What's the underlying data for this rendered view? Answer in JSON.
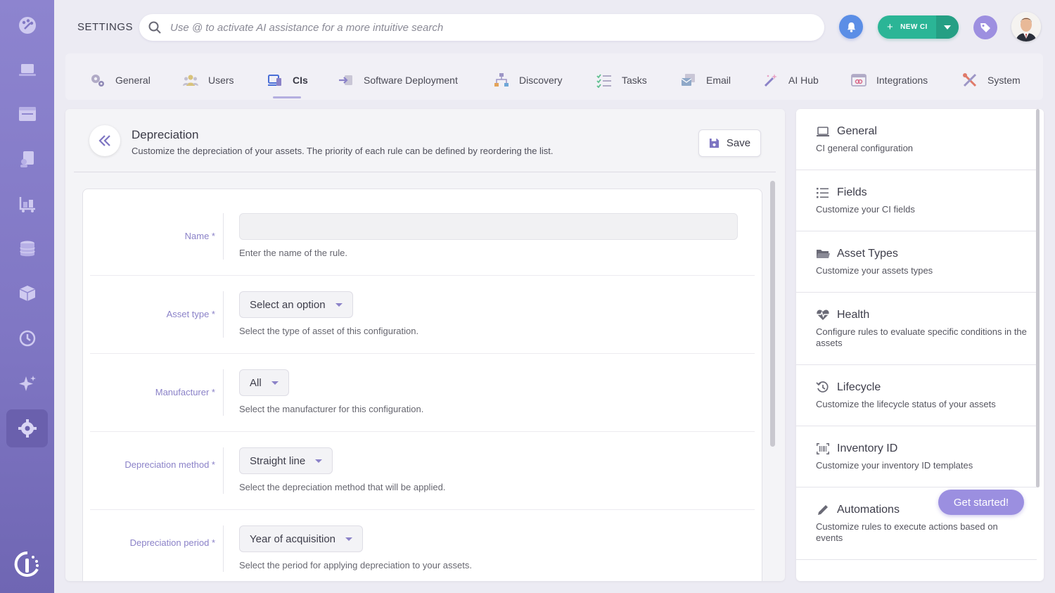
{
  "header": {
    "title": "SETTINGS",
    "search_placeholder": "Use @ to activate AI assistance for a more intuitive search",
    "new_ci_label": "NEW CI"
  },
  "tabs": [
    {
      "label": "General",
      "icon": "gears-icon"
    },
    {
      "label": "Users",
      "icon": "users-icon"
    },
    {
      "label": "CIs",
      "icon": "ci-icon",
      "active": true
    },
    {
      "label": "Software Deployment",
      "icon": "deploy-icon"
    },
    {
      "label": "Discovery",
      "icon": "network-icon"
    },
    {
      "label": "Tasks",
      "icon": "tasks-icon"
    },
    {
      "label": "Email",
      "icon": "email-icon"
    },
    {
      "label": "AI Hub",
      "icon": "magic-wand-icon"
    },
    {
      "label": "Integrations",
      "icon": "integrations-icon"
    },
    {
      "label": "System",
      "icon": "tools-icon"
    }
  ],
  "page": {
    "title": "Depreciation",
    "subtitle": "Customize the depreciation of your assets. The priority of each rule can be defined by reordering the list.",
    "save_label": "Save"
  },
  "form": {
    "name": {
      "label": "Name *",
      "value": "",
      "hint": "Enter the name of the rule."
    },
    "asset_type": {
      "label": "Asset type *",
      "value": "Select an option",
      "hint": "Select the type of asset of this configuration."
    },
    "manufacturer": {
      "label": "Manufacturer *",
      "value": "All",
      "hint": "Select the manufacturer for this configuration."
    },
    "method": {
      "label": "Depreciation method *",
      "value": "Straight line",
      "hint": "Select the depreciation method that will be applied."
    },
    "period": {
      "label": "Depreciation period *",
      "value": "Year of acquisition",
      "hint": "Select the period for applying depreciation to your assets."
    }
  },
  "side": [
    {
      "title": "General",
      "desc": "CI general configuration",
      "icon": "laptop-icon"
    },
    {
      "title": "Fields",
      "desc": "Customize your CI fields",
      "icon": "list-icon"
    },
    {
      "title": "Asset Types",
      "desc": "Customize your assets types",
      "icon": "folder-icon"
    },
    {
      "title": "Health",
      "desc": "Configure rules to evaluate specific conditions in the assets",
      "icon": "heart-pulse-icon"
    },
    {
      "title": "Lifecycle",
      "desc": "Customize the lifecycle status of your assets",
      "icon": "history-icon"
    },
    {
      "title": "Inventory ID",
      "desc": "Customize your inventory ID templates",
      "icon": "barcode-icon"
    },
    {
      "title": "Automations",
      "desc": "Customize rules to execute actions based on events",
      "icon": "pencil-icon"
    }
  ],
  "get_started_label": "Get started!",
  "colors": {
    "accent": "#8b82c8",
    "rail": "#8077c4",
    "new_ci": "#2bb596",
    "bell": "#5b8ee6"
  }
}
